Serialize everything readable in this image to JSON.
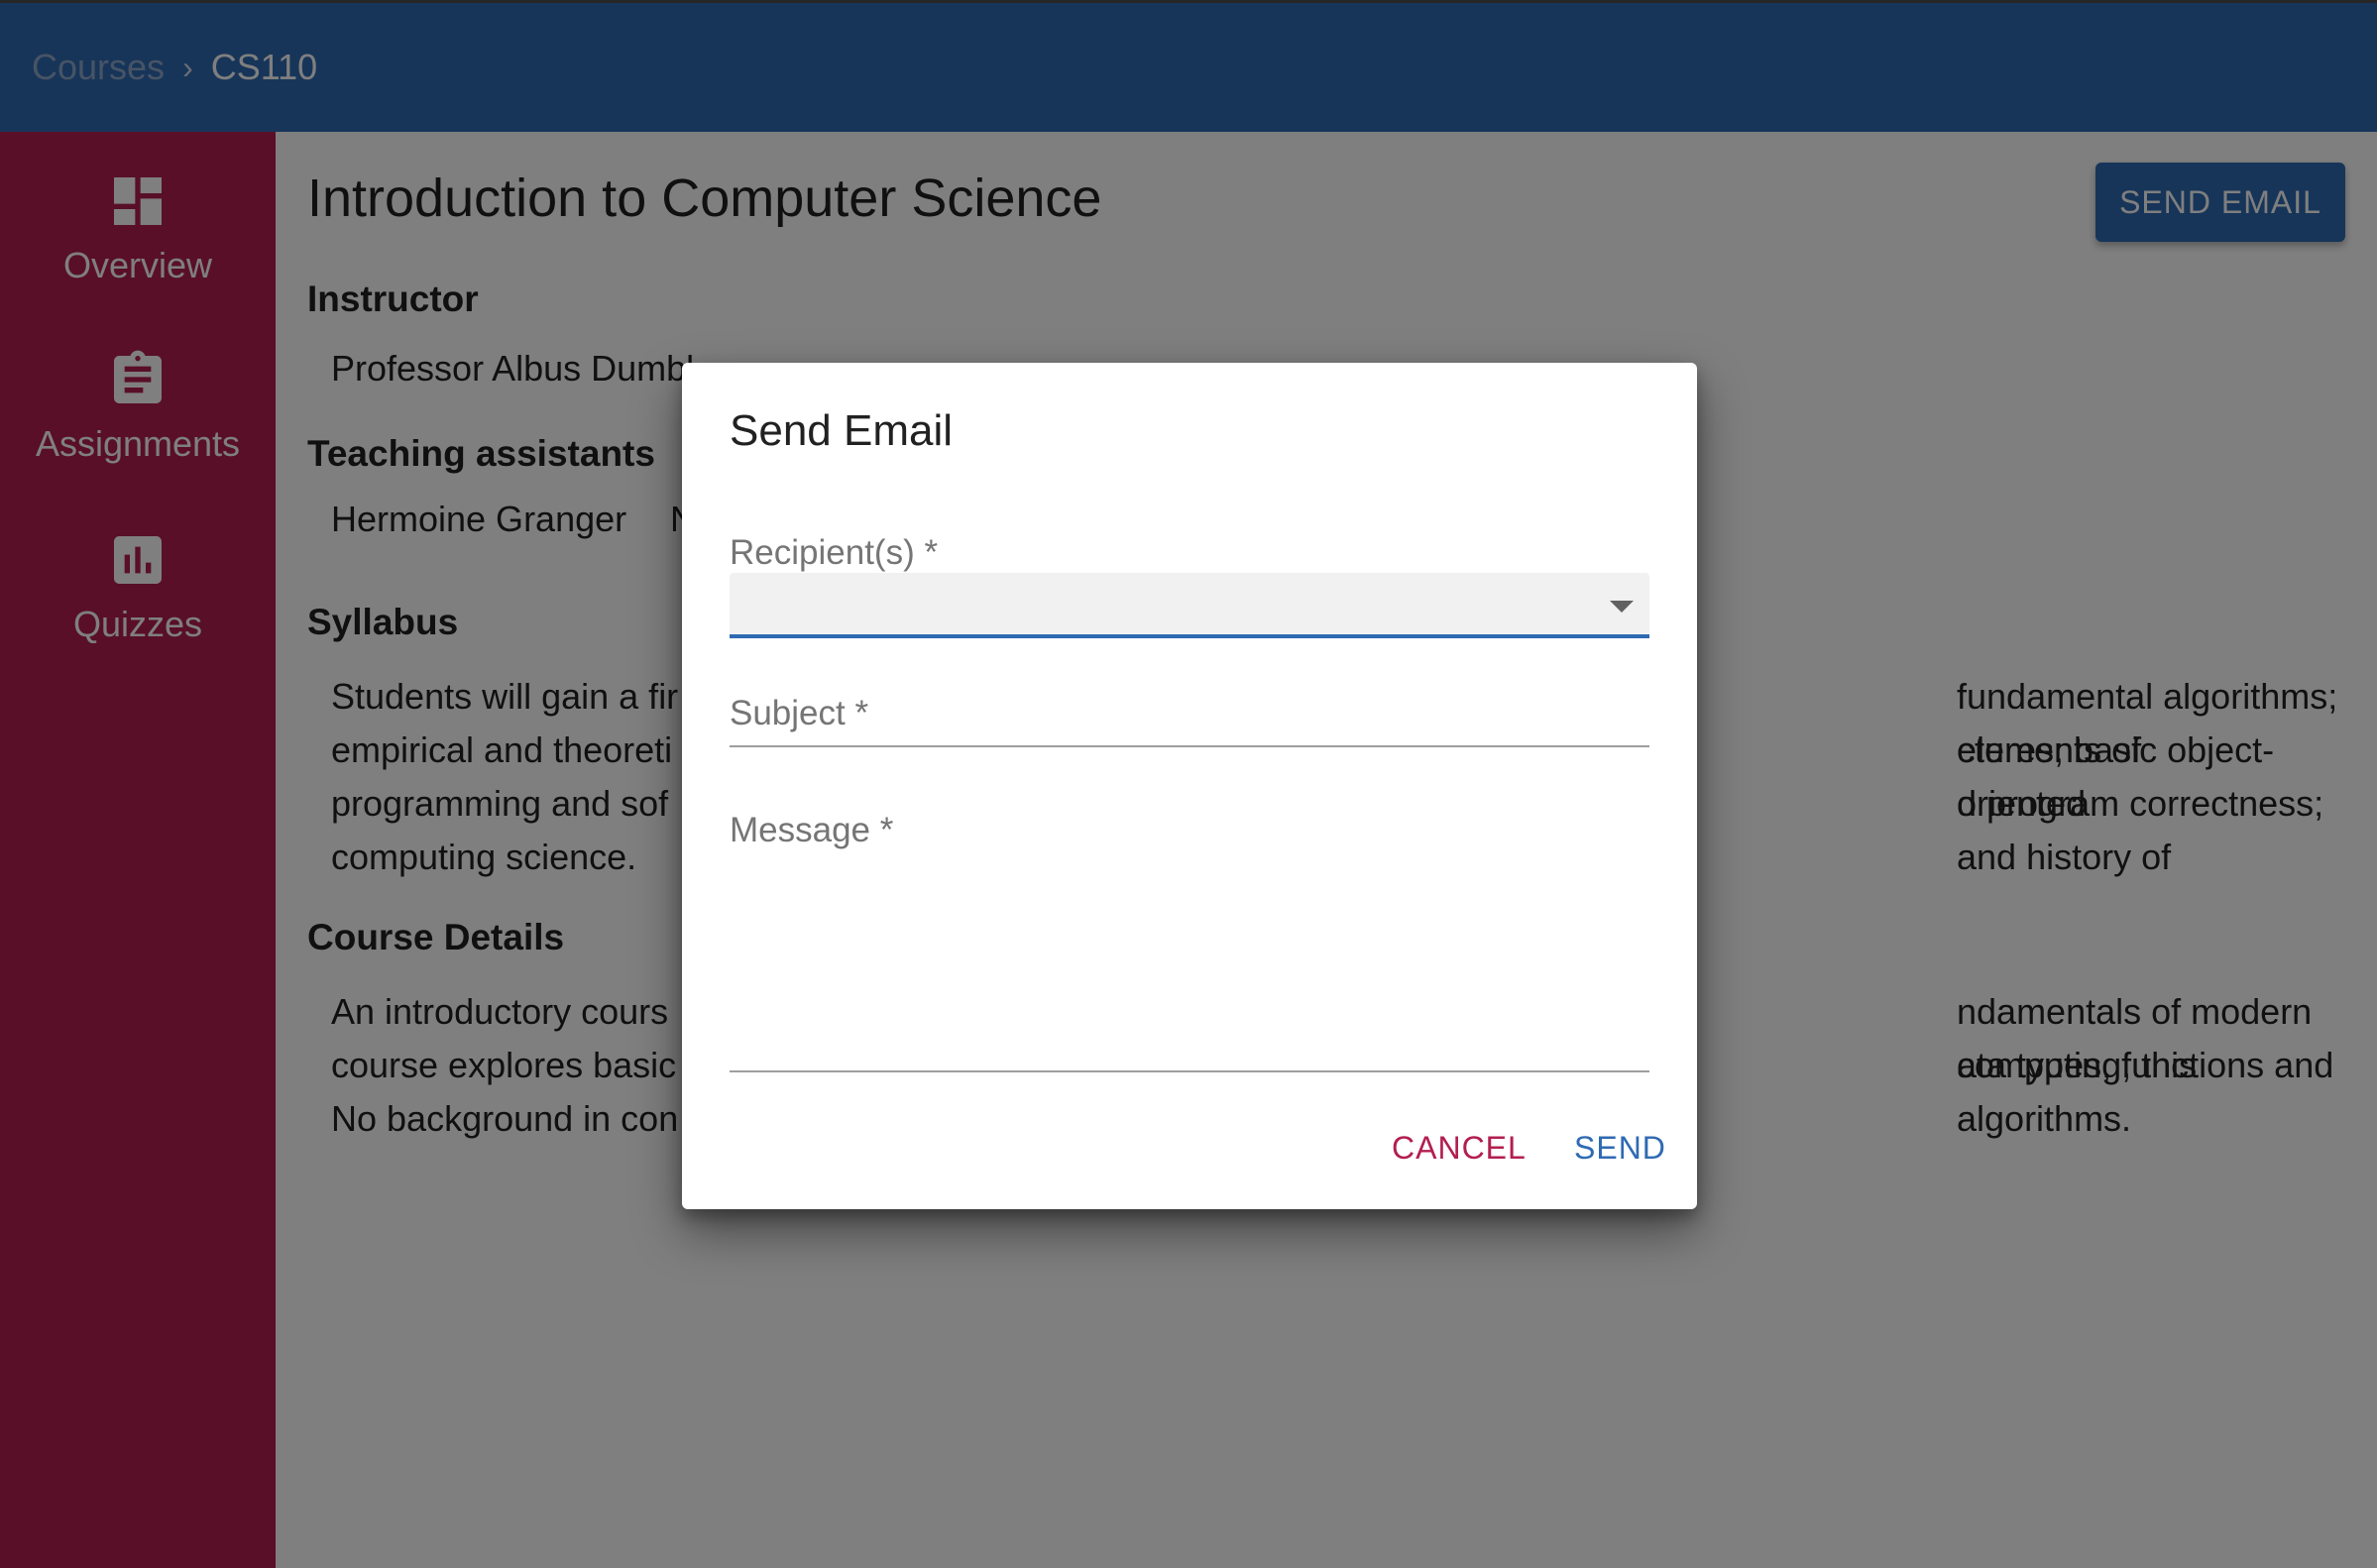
{
  "breadcrumb": {
    "root": "Courses",
    "separator": "›",
    "current": "CS110"
  },
  "sidebar": {
    "items": [
      {
        "label": "Overview",
        "icon": "dashboard-icon"
      },
      {
        "label": "Assignments",
        "icon": "clipboard-icon"
      },
      {
        "label": "Quizzes",
        "icon": "bar-chart-icon"
      }
    ]
  },
  "main": {
    "title": "Introduction to Computer Science",
    "send_email_label": "SEND EMAIL",
    "instructor_heading": "Instructor",
    "instructor_name": "Professor Albus Dumbl",
    "tas_heading": "Teaching assistants",
    "tas": [
      "Hermoine Granger",
      "N"
    ],
    "syllabus_heading": "Syllabus",
    "syllabus_left": [
      "Students will gain a fir",
      "empirical and theoreti",
      "programming and sof",
      "computing science."
    ],
    "syllabus_right": [
      "fundamental algorithms; elements of",
      "ctures; basic object-oriented",
      "d program correctness; and history of",
      ""
    ],
    "details_heading": "Course Details",
    "details_left": [
      "An introductory cours",
      "course explores basic",
      "No background in con"
    ],
    "details_right": [
      "ndamentals of modern computing, this",
      "ata types, functions and algorithms.",
      ""
    ]
  },
  "dialog": {
    "title": "Send Email",
    "recipients_label": "Recipient(s) *",
    "subject_label": "Subject *",
    "message_label": "Message *",
    "cancel_label": "CANCEL",
    "send_label": "SEND"
  },
  "colors": {
    "appbar": "#2f6ab3",
    "sidebar": "#b31e4f",
    "cancel": "#b31e4f",
    "send": "#2f6ab3"
  }
}
